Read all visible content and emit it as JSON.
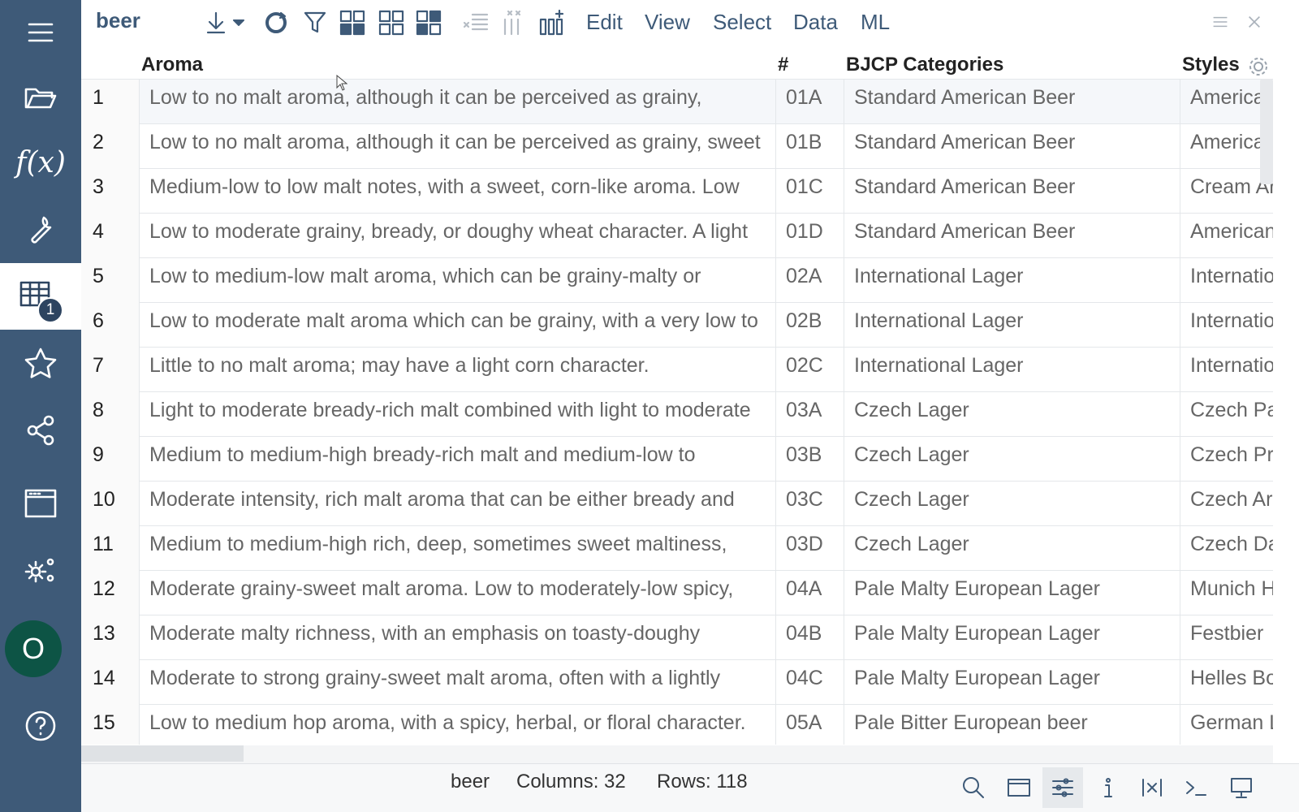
{
  "toolbar": {
    "title": "beer",
    "menu": [
      "Edit",
      "View",
      "Select",
      "Data",
      "ML"
    ]
  },
  "sidebar": {
    "badge": "1",
    "fx_label": "f(x)",
    "avatar_letter": "O"
  },
  "grid": {
    "columns": [
      "Aroma",
      "#",
      "BJCP Categories",
      "Styles"
    ],
    "rows": [
      {
        "n": "1",
        "aroma": "Low to no malt aroma, although it can be perceived as grainy,",
        "code": "01A",
        "category": "Standard American Beer",
        "style": "America"
      },
      {
        "n": "2",
        "aroma": "Low to no malt aroma, although it can be perceived as grainy, sweet",
        "code": "01B",
        "category": "Standard American Beer",
        "style": "America"
      },
      {
        "n": "3",
        "aroma": "Medium-low to low malt notes, with a sweet, corn-like aroma. Low",
        "code": "01C",
        "category": "Standard American Beer",
        "style": "Cream Ar"
      },
      {
        "n": "4",
        "aroma": "Low to moderate grainy, bready, or doughy wheat character. A light",
        "code": "01D",
        "category": "Standard American Beer",
        "style": "American"
      },
      {
        "n": "5",
        "aroma": "Low to medium-low malt aroma, which can be grainy-malty or",
        "code": "02A",
        "category": "International Lager",
        "style": "Internatio"
      },
      {
        "n": "6",
        "aroma": "Low to moderate malt aroma which can be grainy, with a very low to",
        "code": "02B",
        "category": "International Lager",
        "style": "Internatio"
      },
      {
        "n": "7",
        "aroma": "Little to no malt aroma; may have a light corn character.",
        "code": "02C",
        "category": "International Lager",
        "style": "Internatio"
      },
      {
        "n": "8",
        "aroma": "Light to moderate bready-rich malt combined with light to moderate",
        "code": "03A",
        "category": "Czech Lager",
        "style": "Czech Pa"
      },
      {
        "n": "9",
        "aroma": "Medium to medium-high bready-rich malt and medium-low to",
        "code": "03B",
        "category": "Czech Lager",
        "style": "Czech Pr"
      },
      {
        "n": "10",
        "aroma": "Moderate intensity, rich malt aroma that can be either bready and",
        "code": "03C",
        "category": "Czech Lager",
        "style": "Czech Ar"
      },
      {
        "n": "11",
        "aroma": "Medium to medium-high rich, deep, sometimes sweet maltiness,",
        "code": "03D",
        "category": "Czech Lager",
        "style": "Czech Da"
      },
      {
        "n": "12",
        "aroma": "Moderate grainy-sweet malt aroma. Low to moderately-low spicy,",
        "code": "04A",
        "category": "Pale Malty European Lager",
        "style": "Munich H"
      },
      {
        "n": "13",
        "aroma": "Moderate malty richness, with an emphasis on toasty-doughy",
        "code": "04B",
        "category": "Pale Malty European Lager",
        "style": "Festbier"
      },
      {
        "n": "14",
        "aroma": "Moderate to strong grainy-sweet malt aroma, often with a lightly",
        "code": "04C",
        "category": "Pale Malty European Lager",
        "style": "Helles Bo"
      },
      {
        "n": "15",
        "aroma": "Low to medium hop aroma, with a spicy, herbal, or floral character.",
        "code": "05A",
        "category": "Pale Bitter European beer",
        "style": "German L"
      }
    ]
  },
  "status": {
    "table_name": "beer",
    "columns": "Columns: 32",
    "rows": "Rows: 118"
  }
}
